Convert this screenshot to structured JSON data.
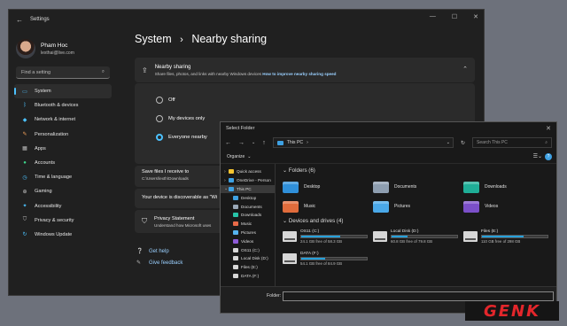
{
  "settings": {
    "window_title": "Settings",
    "profile": {
      "name": "Pham Hoc",
      "email": "lexthai@live.com"
    },
    "search_placeholder": "Find a setting",
    "nav": [
      {
        "label": "System",
        "icon": "monitor-icon",
        "color": "#4cc2ff"
      },
      {
        "label": "Bluetooth & devices",
        "icon": "bluetooth-icon",
        "color": "#4cc2ff"
      },
      {
        "label": "Network & internet",
        "icon": "wifi-icon",
        "color": "#4cc2ff"
      },
      {
        "label": "Personalization",
        "icon": "brush-icon",
        "color": "#f7a35c"
      },
      {
        "label": "Apps",
        "icon": "apps-icon",
        "color": "#c0c0c0"
      },
      {
        "label": "Accounts",
        "icon": "person-icon",
        "color": "#3dd68c"
      },
      {
        "label": "Time & language",
        "icon": "globe-clock-icon",
        "color": "#4cc2ff"
      },
      {
        "label": "Gaming",
        "icon": "gamepad-icon",
        "color": "#c0c0c0"
      },
      {
        "label": "Accessibility",
        "icon": "accessibility-icon",
        "color": "#4cc2ff"
      },
      {
        "label": "Privacy & security",
        "icon": "shield-icon",
        "color": "#c0c0c0"
      },
      {
        "label": "Windows Update",
        "icon": "update-icon",
        "color": "#4cc2ff"
      }
    ],
    "breadcrumb": {
      "parent": "System",
      "separator": "›",
      "current": "Nearby sharing"
    },
    "nearby": {
      "title": "Nearby sharing",
      "subtitle": "Share files, photos, and links with nearby Windows devices",
      "link": "How to improve nearby sharing speed",
      "options": [
        "Off",
        "My devices only",
        "Everyone nearby"
      ],
      "selected": "Everyone nearby"
    },
    "save_card": {
      "title": "Save files I receive to",
      "path": "C:\\Users\\lexth\\Downloads"
    },
    "discoverable_text": "Your device is discoverable as \"Wi",
    "privacy_card": {
      "title": "Privacy Statement",
      "sub": "Understand how Microsoft uses"
    },
    "help_links": [
      "Get help",
      "Give feedback"
    ]
  },
  "dialog": {
    "title": "Select Folder",
    "address": "This PC",
    "search_placeholder": "Search This PC",
    "organize": "Organize",
    "tree": [
      {
        "label": "Quick access",
        "color": "#f4c430"
      },
      {
        "label": "OneDrive - Person",
        "color": "#3ea1e3"
      },
      {
        "label": "This PC",
        "color": "#3ea1e3",
        "selected": true
      },
      {
        "label": "Desktop",
        "color": "#3ea1e3"
      },
      {
        "label": "Documents",
        "color": "#9aa8b8"
      },
      {
        "label": "Downloads",
        "color": "#27c4a8"
      },
      {
        "label": "Music",
        "color": "#e96a48"
      },
      {
        "label": "Pictures",
        "color": "#56b4f0"
      },
      {
        "label": "Videos",
        "color": "#8e5bd8"
      },
      {
        "label": "OS11 (C:)",
        "color": "#d7d7d7"
      },
      {
        "label": "Local Disk (D:)",
        "color": "#d7d7d7"
      },
      {
        "label": "Files (E:)",
        "color": "#d7d7d7"
      },
      {
        "label": "DATA (F:)",
        "color": "#d7d7d7"
      }
    ],
    "folders_header": "Folders (6)",
    "folders": [
      {
        "label": "Desktop",
        "color": "#2f8fd9"
      },
      {
        "label": "Documents",
        "color": "#8e9eb0"
      },
      {
        "label": "Downloads",
        "color": "#1fae97"
      },
      {
        "label": "Music",
        "color": "#e06c3c"
      },
      {
        "label": "Pictures",
        "color": "#4aa8e8"
      },
      {
        "label": "Videos",
        "color": "#7b4fc8"
      }
    ],
    "drives_header": "Devices and drives (4)",
    "drives": [
      {
        "label": "OS11 (C:)",
        "free": "24.1 GB free of 58.3 GB",
        "used_fraction": 0.59
      },
      {
        "label": "Local Disk (D:)",
        "free": "60.8 GB free of 79.8 GB",
        "used_fraction": 0.24
      },
      {
        "label": "Files (E:)",
        "free": "110 GB free of 298 GB",
        "used_fraction": 0.63
      },
      {
        "label": "DATA (F:)",
        "free": "54.1 GB free of 84.9 GB",
        "used_fraction": 0.36
      }
    ],
    "folder_label": "Folder:"
  },
  "watermark": "GENK"
}
